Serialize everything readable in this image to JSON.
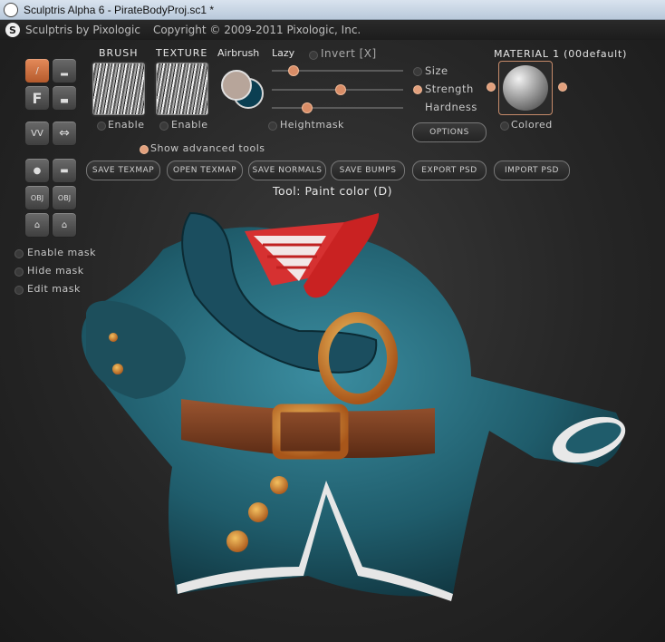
{
  "window": {
    "title": "Sculptris Alpha 6 - PirateBodyProj.sc1 *"
  },
  "header": {
    "app_name": "Sculptris by Pixologic",
    "copyright": "Copyright © 2009-2011 Pixologic, Inc."
  },
  "toolbar_left": {
    "buttons": [
      {
        "name": "brush-paint",
        "glyph": "/"
      },
      {
        "name": "flatten",
        "glyph": "▂"
      },
      {
        "name": "fill",
        "glyph": "F"
      },
      {
        "name": "smooth",
        "glyph": "▃"
      },
      {
        "name": "pinch",
        "glyph": "VV"
      },
      {
        "name": "grab",
        "glyph": "⇔"
      },
      {
        "name": "inflate",
        "glyph": "●"
      },
      {
        "name": "crease",
        "glyph": "▬"
      },
      {
        "name": "obj-import",
        "glyph": "OBJ"
      },
      {
        "name": "obj-export",
        "glyph": "OBJ"
      },
      {
        "name": "lock-1",
        "glyph": "⌂"
      },
      {
        "name": "lock-2",
        "glyph": "⌂"
      }
    ],
    "mask_options": [
      "Enable mask",
      "Hide mask",
      "Edit mask"
    ]
  },
  "brush": {
    "label": "BRUSH",
    "enable_label": "Enable"
  },
  "texture": {
    "label": "TEXTURE",
    "enable_label": "Enable"
  },
  "airbrush_label": "Airbrush",
  "lazy_label": "Lazy",
  "invert_label": "Invert [X]",
  "heightmask_label": "Heightmask",
  "size_label": "Size",
  "strength_label": "Strength",
  "hardness_label": "Hardness",
  "options_label": "OPTIONS",
  "material": {
    "label": "MATERIAL 1 (00default)",
    "colored_label": "Colored"
  },
  "show_advanced": "Show advanced tools",
  "action_buttons": [
    "SAVE TEXMAP",
    "OPEN TEXMAP",
    "SAVE NORMALS",
    "SAVE BUMPS",
    "EXPORT PSD",
    "IMPORT PSD"
  ],
  "tool_status": "Tool: Paint color (D)",
  "colors": {
    "accent": "#d98d67",
    "model_teal": "#1f5c6b",
    "belt": "#7a3f22",
    "buckle": "#d88a28"
  }
}
